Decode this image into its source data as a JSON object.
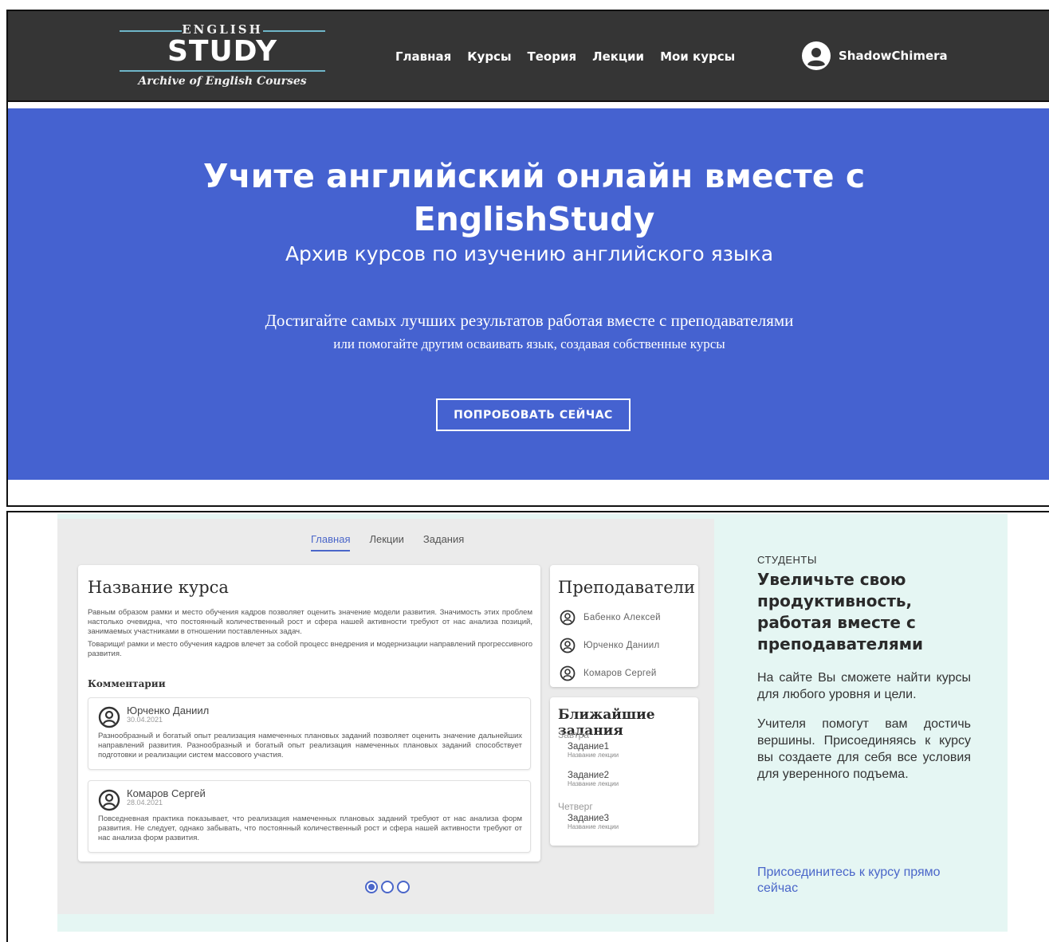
{
  "header": {
    "logo": {
      "top": "ENGLISH",
      "main": "STUDY",
      "sub": "Archive of English Courses"
    },
    "nav": [
      "Главная",
      "Курсы",
      "Теория",
      "Лекции",
      "Мои курсы"
    ],
    "user": {
      "name": "ShadowChimera",
      "icon": "user-circle-icon"
    }
  },
  "hero": {
    "title": "Учите английский онлайн вместе с EnglishStudy",
    "subtitle": "Архив курсов по изучению английского языка",
    "lead": "Достигайте самых лучших результатов работая вместе с преподавателями",
    "lead2": "или помогайте другим осваивать язык, создавая собственные курсы",
    "cta": "ПОПРОБОВАТЬ СЕЙЧАС",
    "background": "#4562d0"
  },
  "preview": {
    "tabs": [
      "Главная",
      "Лекции",
      "Задания"
    ],
    "active_tab": "Главная",
    "course": {
      "title": "Название курса",
      "paragraphs": [
        "Равным образом рамки и место обучения кадров позволяет оценить значение модели развития. Значимость этих проблем настолько очевидна, что постоянный количественный рост и сфера нашей активности требуют от нас анализа позиций, занимаемых участниками в отношении поставленных задач.",
        "Товарищи! рамки и место обучения кадров влечет за собой процесс внедрения и модернизации направлений прогрессивного развития."
      ],
      "comments_title": "Комментарии",
      "comments": [
        {
          "author": "Юрченко Даниил",
          "date": "30.04.2021",
          "text": "Разнообразный и богатый опыт реализация намеченных плановых заданий позволяет оценить значение дальнейших направлений развития. Разнообразный и богатый опыт реализация намеченных плановых заданий способствует подготовки и реализации систем массового участия."
        },
        {
          "author": "Комаров Сергей",
          "date": "28.04.2021",
          "text": "Повседневная практика показывает, что реализация намеченных плановых заданий требуют от нас анализа форм развития. Не следует, однако забывать, что постоянный количественный рост и сфера нашей активности требуют от нас анализа форм развития."
        }
      ]
    },
    "teachers": {
      "title": "Преподаватели",
      "items": [
        "Бабенко Алексей",
        "Юрченко Даниил",
        "Комаров Сергей"
      ]
    },
    "tasks": {
      "title": "Ближайшие задания",
      "groups": [
        {
          "day": "Завтра",
          "items": [
            {
              "name": "Задание1",
              "lecture": "Название лекции"
            },
            {
              "name": "Задание2",
              "lecture": "Название лекции"
            }
          ]
        },
        {
          "day": "Четверг",
          "items": [
            {
              "name": "Задание3",
              "lecture": "Название лекции"
            }
          ]
        }
      ]
    },
    "slider": {
      "count": 3,
      "active": 1
    }
  },
  "promo": {
    "kicker": "СТУДЕНТЫ",
    "title": "Увеличьте свою продуктивность, работая вместе с преподавателями",
    "text1": "На сайте Вы сможете найти курсы для любого уровня и цели.",
    "text2": "Учителя помогут вам достичь вершины. Присоединяясь к курсу вы создаете для себя все условия для уверенного подъема.",
    "link": "Присоединитесь к курсу прямо сейчас"
  },
  "colors": {
    "header_bg": "#353535",
    "accent": "#4a66c9",
    "mint": "#e5f6f3"
  }
}
